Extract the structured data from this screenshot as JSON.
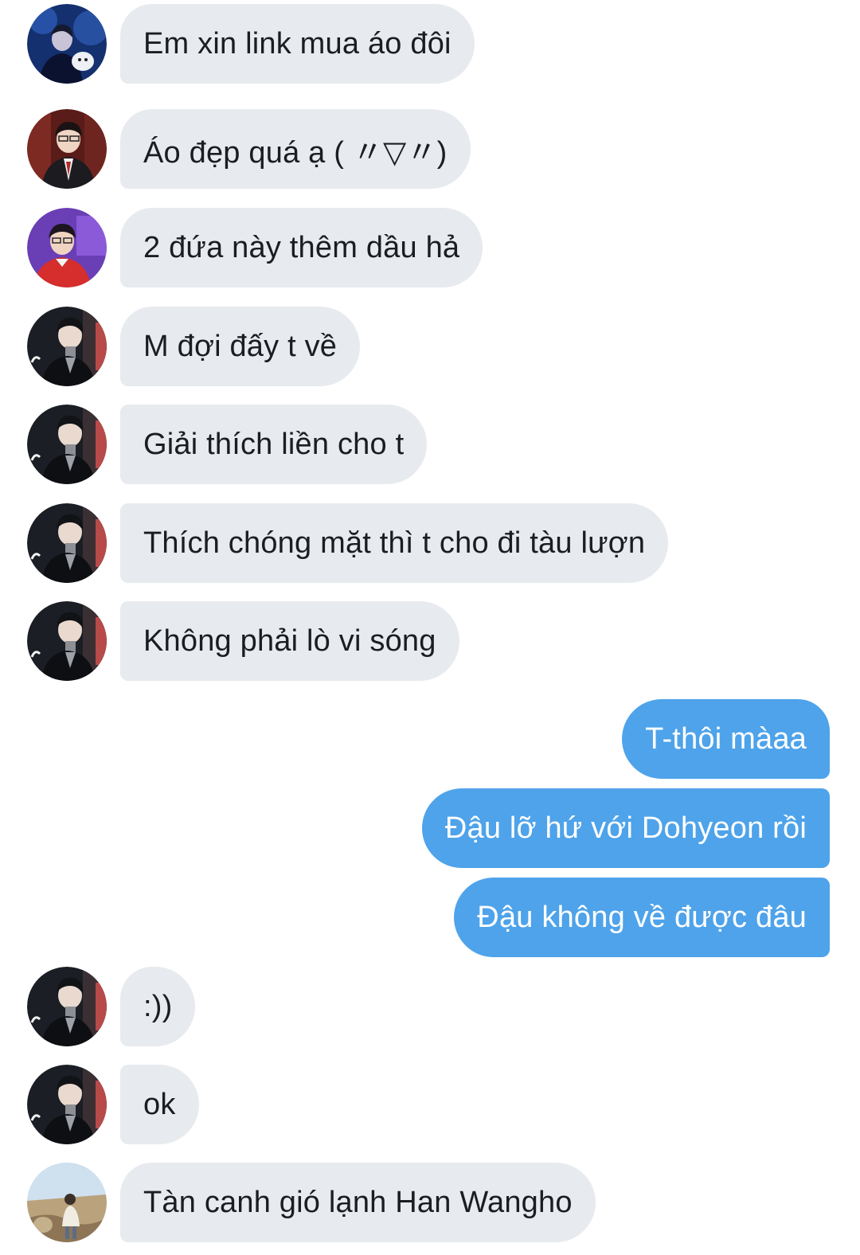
{
  "conversation": {
    "messages": [
      {
        "sender": "avatar-blue-stage",
        "direction": "in",
        "text": "Em xin link mua áo đôi"
      },
      {
        "sender": "avatar-red-jacket",
        "direction": "in",
        "text": "Áo đẹp quá ạ ( 〃▽〃)"
      },
      {
        "sender": "avatar-purple-red",
        "direction": "in",
        "text": "2 đứa này thêm dầu hả"
      },
      {
        "sender": "avatar-dark-coat",
        "direction": "in",
        "text": "M đợi đấy t về"
      },
      {
        "sender": "avatar-dark-coat",
        "direction": "in",
        "text": "Giải thích liền cho t"
      },
      {
        "sender": "avatar-dark-coat",
        "direction": "in",
        "text": "Thích chóng mặt thì t cho đi tàu lượn"
      },
      {
        "sender": "avatar-dark-coat",
        "direction": "in",
        "text": "Không phải lò vi sóng"
      },
      {
        "sender": "me",
        "direction": "out",
        "text": "T-thôi màaa"
      },
      {
        "sender": "me",
        "direction": "out",
        "text": "Đậu lỡ hứ với Dohyeon rồi"
      },
      {
        "sender": "me",
        "direction": "out",
        "text": "Đậu không về được đâu"
      },
      {
        "sender": "avatar-dark-coat",
        "direction": "in",
        "text": ":))"
      },
      {
        "sender": "avatar-dark-coat",
        "direction": "in",
        "text": "ok"
      },
      {
        "sender": "avatar-outdoor-field",
        "direction": "in",
        "text": "Tàn canh gió lạnh Han Wangho"
      }
    ]
  },
  "colors": {
    "incoming_bubble": "#e7eaee",
    "outgoing_bubble": "#4ea3ea",
    "incoming_text": "#1a1d21",
    "outgoing_text": "#ffffff"
  }
}
